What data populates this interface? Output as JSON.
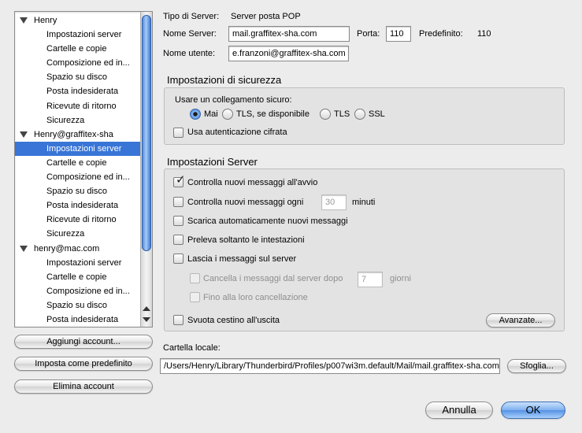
{
  "sidebar": {
    "accounts": [
      {
        "name": "Henry",
        "items": [
          "Impostazioni server",
          "Cartelle e copie",
          "Composizione ed in...",
          "Spazio su disco",
          "Posta indesiderata",
          "Ricevute di ritorno",
          "Sicurezza"
        ]
      },
      {
        "name": "Henry@graffitex-sha",
        "items": [
          "Impostazioni server",
          "Cartelle e copie",
          "Composizione ed in...",
          "Spazio su disco",
          "Posta indesiderata",
          "Ricevute di ritorno",
          "Sicurezza"
        ],
        "selected_item": 0
      },
      {
        "name": "henry@mac.com",
        "items": [
          "Impostazioni server",
          "Cartelle e copie",
          "Composizione ed in...",
          "Spazio su disco",
          "Posta indesiderata"
        ]
      }
    ],
    "buttons": {
      "add": "Aggiungi account...",
      "default": "Imposta come predefinito",
      "delete": "Elimina account"
    }
  },
  "server": {
    "type_label": "Tipo di Server:",
    "type_value": "Server posta POP",
    "name_label": "Nome Server:",
    "name_value": "mail.graffitex-sha.com",
    "port_label": "Porta:",
    "port_value": "110",
    "default_label": "Predefinito:",
    "default_value": "110",
    "user_label": "Nome utente:",
    "user_value": "e.franzoni@graffitex-sha.com"
  },
  "security": {
    "title": "Impostazioni di sicurezza",
    "secure_label": "Usare un collegamento sicuro:",
    "options": [
      "Mai",
      "TLS, se disponibile",
      "TLS",
      "SSL"
    ],
    "selected": "Mai",
    "encrypted_auth": "Usa autenticazione cifrata"
  },
  "server_settings": {
    "title": "Impostazioni Server",
    "check_startup": "Controlla nuovi messaggi all'avvio",
    "check_every": "Controlla nuovi messaggi ogni",
    "check_every_value": "30",
    "minutes": "minuti",
    "auto_download": "Scarica automaticamente nuovi messaggi",
    "headers_only": "Preleva soltanto le intestazioni",
    "leave_on_server": "Lascia i messaggi sul server",
    "delete_after": "Cancella i messaggi dal server dopo",
    "delete_after_value": "7",
    "days": "giorni",
    "until_deleted": "Fino alla loro cancellazione",
    "empty_trash": "Svuota cestino all'uscita",
    "advanced": "Avanzate..."
  },
  "local_folder": {
    "label": "Cartella locale:",
    "path": "/Users/Henry/Library/Thunderbird/Profiles/p007wi3m.default/Mail/mail.graffitex-sha.com",
    "browse": "Sfoglia..."
  },
  "footer": {
    "cancel": "Annulla",
    "ok": "OK"
  }
}
